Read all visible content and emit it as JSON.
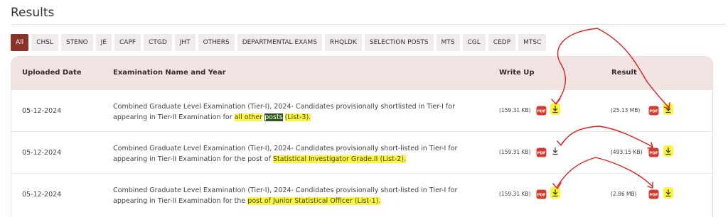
{
  "page": {
    "title": "Results"
  },
  "filters": [
    "All",
    "CHSL",
    "STENO",
    "JE",
    "CAPF",
    "CTGD",
    "JHT",
    "OTHERS",
    "DEPARTMENTAL EXAMS",
    "RHQLDK",
    "SELECTION POSTS",
    "MTS",
    "CGL",
    "CEDP",
    "MTSC"
  ],
  "active_filter": "All",
  "table": {
    "headers": {
      "date": "Uploaded Date",
      "exam": "Examination Name and Year",
      "writeup": "Write Up",
      "result": "Result"
    },
    "rows": [
      {
        "date": "05-12-2024",
        "exam_line1": "Combined Graduate Level Examination (Tier-I), 2024- Candidates provisionally shortlisted in Tier-I for",
        "exam_line2_a": "appearing in Tier-II Examination for",
        "exam_line2_hl1": "all other",
        "exam_line2_hl2": "posts",
        "exam_line2_hl3": "(List-3).",
        "writeup_size": "(159.31 KB)",
        "result_size": "(25.13 MB)"
      },
      {
        "date": "05-12-2024",
        "exam_line1": "Combined Graduate Level Examination (Tier-I), 2024- Candidates provisionally short-listed in Tier-I for",
        "exam_line2_a": "appearing in Tier-II Examination for the post of",
        "exam_line2_hl1": "Statistical Investigator Grade.II (List-2).",
        "writeup_size": "(159.31 KB)",
        "result_size": "(493.15 KB)"
      },
      {
        "date": "05-12-2024",
        "exam_line1": "Combined Graduate Level Examination (Tier-I), 2024- Candidates provisionally short-listed in Tier-I for",
        "exam_line2_a": "appearing in Tier-II Examination for the",
        "exam_line2_hl1": "post of Junior Statistical Officer (List-1).",
        "writeup_size": "(159.31 KB)",
        "result_size": "(2.86 MB)"
      }
    ]
  },
  "icons": {
    "pdf": "pdf-icon",
    "download": "download-icon"
  },
  "colors": {
    "accent": "#8b3328",
    "header_bg": "#f1e3e1",
    "highlight": "#fbf63a",
    "annotation": "#e0201c",
    "pdf": "#d63a2f"
  }
}
